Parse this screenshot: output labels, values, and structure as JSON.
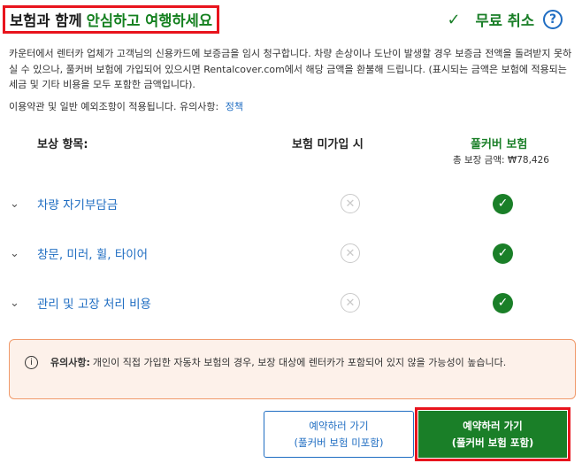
{
  "header": {
    "title_plain": "보험과 함께",
    "title_accent": "안심하고 여행하세요",
    "check_symbol": "✓",
    "free_cancel": "무료 취소",
    "help_symbol": "?"
  },
  "description": "카운터에서 렌터카 업체가 고객님의 신용카드에 보증금을 임시 청구합니다. 차량 손상이나 도난이 발생할 경우 보증금 전액을 돌려받지 못하실 수 있으나, 풀커버 보험에 가입되어 있으시면 Rentalcover.com에서 해당 금액을 환불해 드립니다. (표시되는 금액은 보험에 적용되는 세금 및 기타 비용을 모두 포함한 금액입니다).",
  "terms": {
    "text": "이용약관 및 일반 예외조항이 적용됩니다. 유의사항:",
    "link": "정책"
  },
  "table": {
    "col_coverage": "보상 항목:",
    "col_without": "보험 미가입 시",
    "col_full": "풀커버 보험",
    "total_label": "총 보장 금액: ₩78,426",
    "rows": [
      {
        "label": "차량 자기부담금"
      },
      {
        "label": "창문, 미러, 휠, 타이어"
      },
      {
        "label": "관리 및 고장 처리 비용"
      }
    ],
    "chevron_symbol": "⌄",
    "x_symbol": "✕",
    "ok_symbol": "✓"
  },
  "notice": {
    "icon": "i",
    "title": "유의사항:",
    "text": "개인이 직접 가입한 자동차 보험의 경우, 보장 대상에 렌터카가 포함되어 있지 않을 가능성이 높습니다."
  },
  "buttons": {
    "basic_line1": "예약하러 가기",
    "basic_line2": "(풀커버 보험 미포함)",
    "full_line1": "예약하러 가기",
    "full_line2": "(풀커버 보험 포함)"
  },
  "colors": {
    "accent_green": "#1a7f28",
    "link_blue": "#1f6dc2",
    "highlight_red": "#e8141d",
    "notice_bg": "#fdf1ea"
  }
}
